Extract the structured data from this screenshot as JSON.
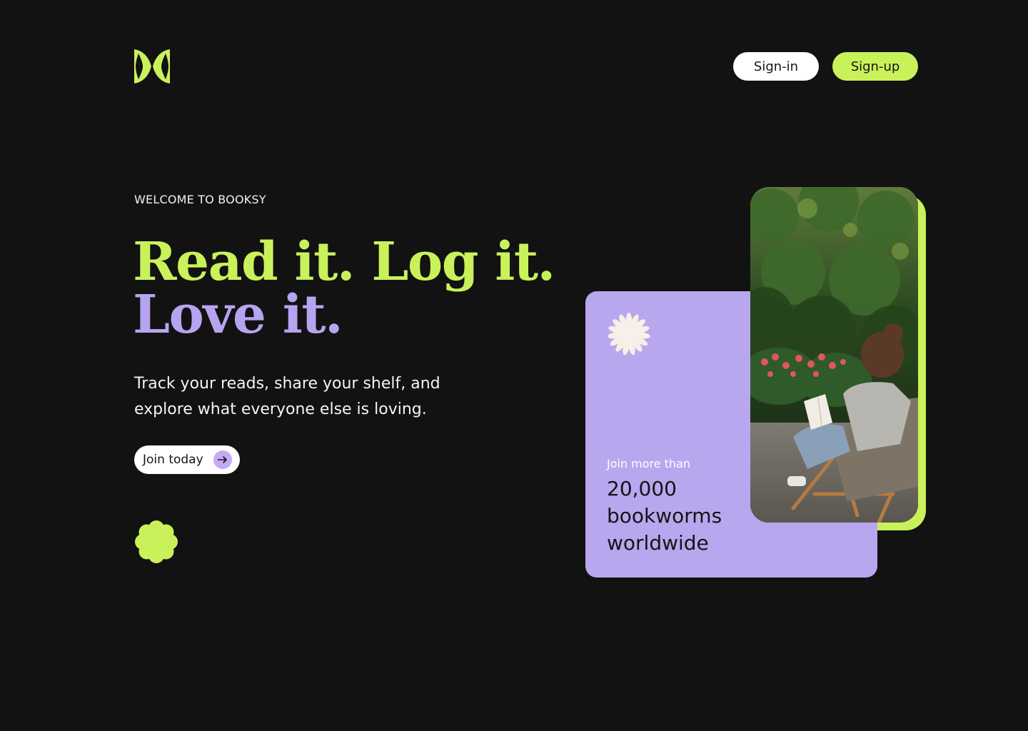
{
  "header": {
    "logo": "booksy-logo",
    "signin_label": "Sign-in",
    "signup_label": "Sign-up"
  },
  "hero": {
    "eyebrow": "WELCOME TO BOOKSY",
    "headline_line1": "Read it. Log it.",
    "headline_line2": "Love it.",
    "subcopy": "Track your reads, share your shelf, and explore what everyone else is loving.",
    "cta_label": "Join today",
    "cta_icon": "arrow-right-icon"
  },
  "stat_card": {
    "pre": "Join more than",
    "big": "20,000 bookworms worldwide",
    "icon": "daisy-icon"
  },
  "photo": {
    "subject": "reader-in-deck-chair-photo"
  },
  "colors": {
    "background": "#121212",
    "lime": "#c9f25a",
    "lavender": "#b8a7ef",
    "white": "#ffffff"
  }
}
